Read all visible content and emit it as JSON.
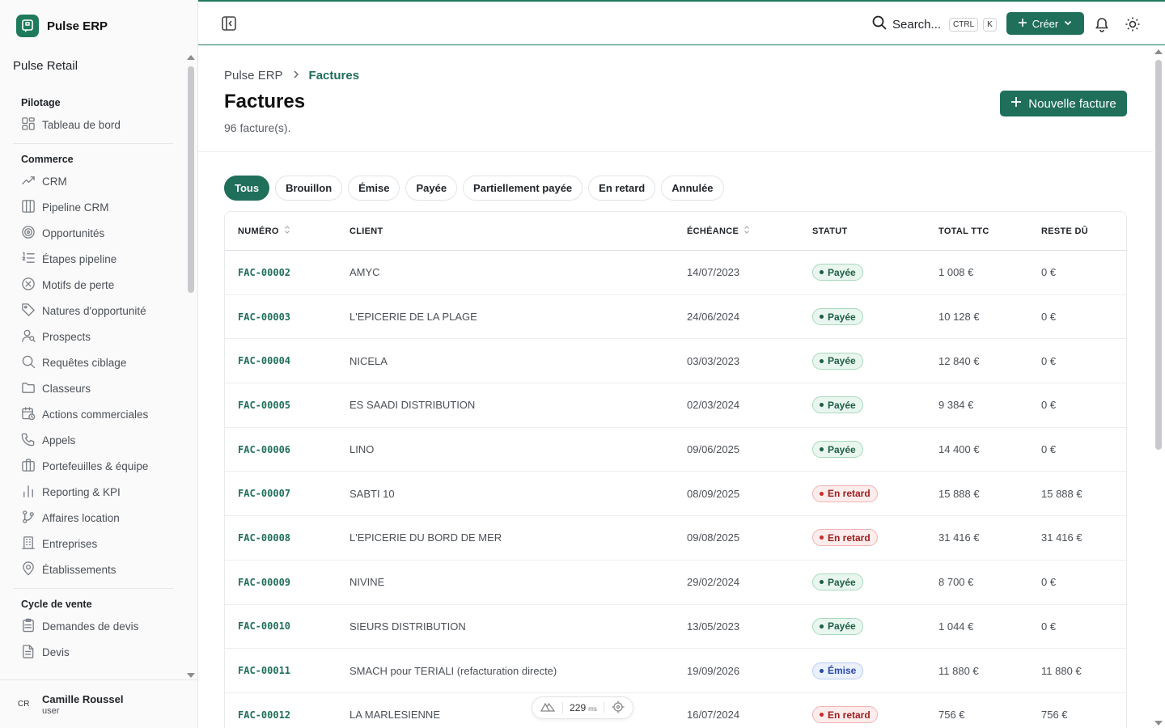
{
  "app": {
    "name": "Pulse ERP",
    "organization": "Pulse Retail"
  },
  "sidebar": {
    "sections": [
      {
        "title": "Pilotage",
        "items": [
          {
            "label": "Tableau de bord",
            "icon": "dashboard-icon"
          }
        ]
      },
      {
        "title": "Commerce",
        "items": [
          {
            "label": "CRM",
            "icon": "trend-icon"
          },
          {
            "label": "Pipeline CRM",
            "icon": "columns-icon"
          },
          {
            "label": "Opportunités",
            "icon": "target-icon"
          },
          {
            "label": "Étapes pipeline",
            "icon": "list-ordered-icon"
          },
          {
            "label": "Motifs de perte",
            "icon": "x-circle-icon"
          },
          {
            "label": "Natures d'opportunité",
            "icon": "tag-icon"
          },
          {
            "label": "Prospects",
            "icon": "user-search-icon"
          },
          {
            "label": "Requêtes ciblage",
            "icon": "search-icon"
          },
          {
            "label": "Classeurs",
            "icon": "folder-icon"
          },
          {
            "label": "Actions commerciales",
            "icon": "calendar-clock-icon"
          },
          {
            "label": "Appels",
            "icon": "phone-icon"
          },
          {
            "label": "Portefeuilles & équipe",
            "icon": "briefcase-icon"
          },
          {
            "label": "Reporting & KPI",
            "icon": "bar-chart-icon"
          },
          {
            "label": "Affaires location",
            "icon": "branch-icon"
          },
          {
            "label": "Entreprises",
            "icon": "building-icon"
          },
          {
            "label": "Établissements",
            "icon": "map-pin-icon"
          }
        ]
      },
      {
        "title": "Cycle de vente",
        "items": [
          {
            "label": "Demandes de devis",
            "icon": "clipboard-list-icon"
          },
          {
            "label": "Devis",
            "icon": "file-text-icon"
          }
        ]
      }
    ]
  },
  "user": {
    "initials": "CR",
    "name": "Camille Roussel",
    "role": "user"
  },
  "topbar": {
    "search_label": "Search...",
    "shortcut_keys": [
      "CTRL",
      "K"
    ],
    "create_label": "Créer"
  },
  "page": {
    "breadcrumb_root": "Pulse ERP",
    "breadcrumb_current": "Factures",
    "title": "Factures",
    "subtitle": "96 facture(s).",
    "new_button_label": "Nouvelle facture"
  },
  "filters": {
    "tabs": [
      "Tous",
      "Brouillon",
      "Émise",
      "Payée",
      "Partiellement payée",
      "En retard",
      "Annulée"
    ],
    "active": "Tous"
  },
  "table": {
    "columns": [
      "NUMÉRO",
      "CLIENT",
      "ÉCHÉANCE",
      "STATUT",
      "TOTAL TTC",
      "RESTE DÛ"
    ],
    "rows": [
      {
        "numero": "FAC-00002",
        "client": "AMYC",
        "echeance": "14/07/2023",
        "statut": "Payée",
        "statut_kind": "paid",
        "total": "1 008 €",
        "reste": "0 €"
      },
      {
        "numero": "FAC-00003",
        "client": "L'EPICERIE DE LA PLAGE",
        "echeance": "24/06/2024",
        "statut": "Payée",
        "statut_kind": "paid",
        "total": "10 128 €",
        "reste": "0 €"
      },
      {
        "numero": "FAC-00004",
        "client": "NICELA",
        "echeance": "03/03/2023",
        "statut": "Payée",
        "statut_kind": "paid",
        "total": "12 840 €",
        "reste": "0 €"
      },
      {
        "numero": "FAC-00005",
        "client": "ES SAADI DISTRIBUTION",
        "echeance": "02/03/2024",
        "statut": "Payée",
        "statut_kind": "paid",
        "total": "9 384 €",
        "reste": "0 €"
      },
      {
        "numero": "FAC-00006",
        "client": "LINO",
        "echeance": "09/06/2025",
        "statut": "Payée",
        "statut_kind": "paid",
        "total": "14 400 €",
        "reste": "0 €"
      },
      {
        "numero": "FAC-00007",
        "client": "SABTI 10",
        "echeance": "08/09/2025",
        "statut": "En retard",
        "statut_kind": "late",
        "total": "15 888 €",
        "reste": "15 888 €"
      },
      {
        "numero": "FAC-00008",
        "client": "L'EPICERIE DU BORD DE MER",
        "echeance": "09/08/2025",
        "statut": "En retard",
        "statut_kind": "late",
        "total": "31 416 €",
        "reste": "31 416 €"
      },
      {
        "numero": "FAC-00009",
        "client": "NIVINE",
        "echeance": "29/02/2024",
        "statut": "Payée",
        "statut_kind": "paid",
        "total": "8 700 €",
        "reste": "0 €"
      },
      {
        "numero": "FAC-00010",
        "client": "SIEURS DISTRIBUTION",
        "echeance": "13/05/2023",
        "statut": "Payée",
        "statut_kind": "paid",
        "total": "1 044 €",
        "reste": "0 €"
      },
      {
        "numero": "FAC-00011",
        "client": "SMACH pour TERIALI (refacturation directe)",
        "echeance": "19/09/2026",
        "statut": "Émise",
        "statut_kind": "issued",
        "total": "11 880 €",
        "reste": "11 880 €"
      },
      {
        "numero": "FAC-00012",
        "client": "LA MARLESIENNE",
        "echeance": "16/07/2024",
        "statut": "En retard",
        "statut_kind": "late",
        "total": "756 €",
        "reste": "756 €"
      }
    ]
  },
  "dev_indicator": {
    "value": "229",
    "unit": "ms"
  },
  "colors": {
    "primary": "#1f6f5b",
    "paid": "#1d5e46",
    "late": "#c92a2a",
    "issued": "#2949a8"
  }
}
